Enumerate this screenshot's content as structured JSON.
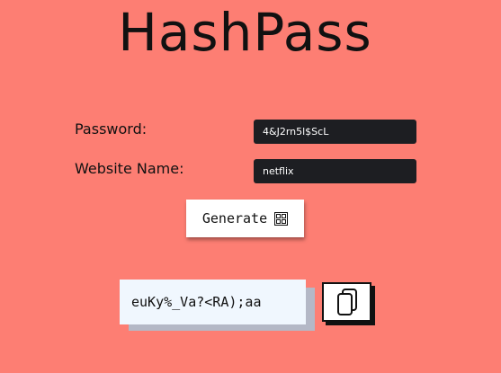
{
  "app": {
    "title": "HashPass"
  },
  "form": {
    "password_label": "Password:",
    "password_value": "4&J2rn5l$ScL",
    "website_label": "Website Name:",
    "website_value": "netflix"
  },
  "actions": {
    "generate_label": "Generate",
    "generate_icon": "grid-icon"
  },
  "output": {
    "value": "euKy%_Va?<RA);aa",
    "copy_icon": "copy-icon"
  },
  "colors": {
    "background": "#fd7e73",
    "input_background": "#1d1e22",
    "output_background": "#f0f7fe",
    "output_shadow": "#b4b8c6"
  }
}
